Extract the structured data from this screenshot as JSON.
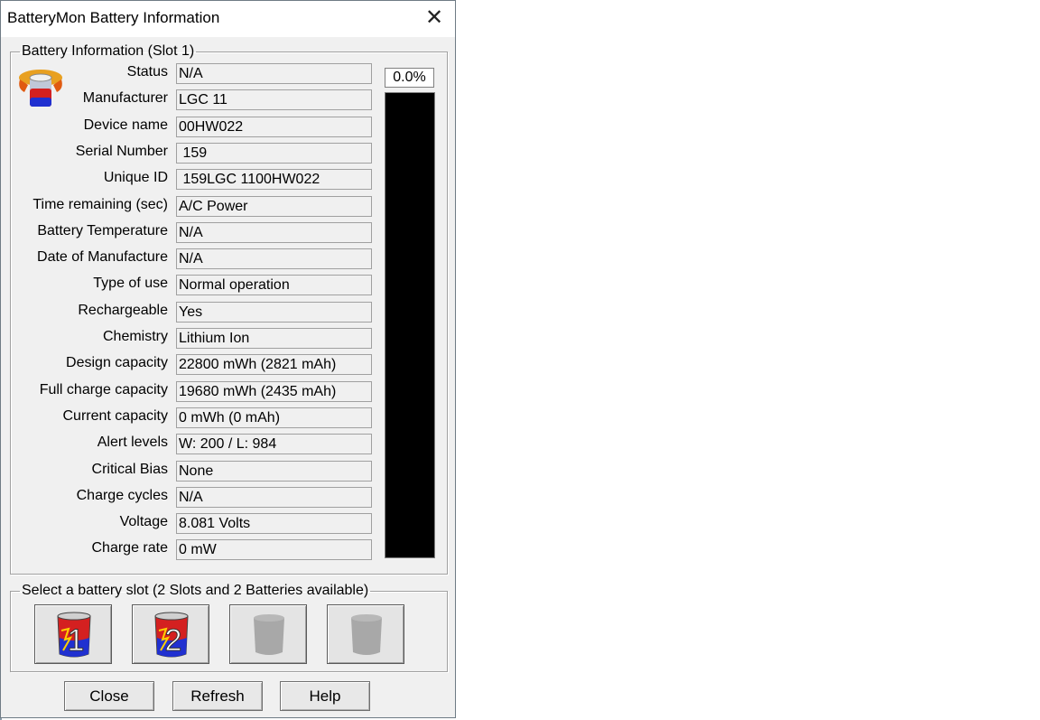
{
  "window": {
    "title": "BatteryMon Battery Information",
    "close_glyph": "✕"
  },
  "info_group": {
    "legend": "Battery Information (Slot 1)",
    "rows": [
      {
        "label": "Status",
        "value": "N/A"
      },
      {
        "label": "Manufacturer",
        "value": "LGC 11"
      },
      {
        "label": "Device name",
        "value": "00HW022"
      },
      {
        "label": "Serial Number",
        "value": " 159"
      },
      {
        "label": "Unique ID",
        "value": " 159LGC 1100HW022"
      },
      {
        "label": "Time remaining (sec)",
        "value": "A/C Power"
      },
      {
        "label": "Battery Temperature",
        "value": "N/A"
      },
      {
        "label": "Date of Manufacture",
        "value": "N/A"
      },
      {
        "label": "Type of use",
        "value": "Normal operation"
      },
      {
        "label": "Rechargeable",
        "value": "Yes"
      },
      {
        "label": "Chemistry",
        "value": "Lithium Ion"
      },
      {
        "label": "Design capacity",
        "value": "22800 mWh (2821 mAh)"
      },
      {
        "label": "Full charge capacity",
        "value": "19680 mWh (2435 mAh)"
      },
      {
        "label": "Current capacity",
        "value": "0 mWh (0 mAh)"
      },
      {
        "label": "Alert levels",
        "value": "W: 200 / L: 984"
      },
      {
        "label": "Critical Bias",
        "value": "None"
      },
      {
        "label": "Charge cycles",
        "value": "N/A"
      },
      {
        "label": "Voltage",
        "value": "8.081 Volts"
      },
      {
        "label": "Charge rate",
        "value": "0 mW"
      }
    ],
    "charge_percent_text": "0.0%",
    "charge_fraction": 0.0
  },
  "slot_group": {
    "legend": "Select a battery slot (2 Slots and 2 Batteries available)",
    "slots": [
      {
        "number": "1",
        "available": true,
        "icon": "battery-slot-1-icon"
      },
      {
        "number": "2",
        "available": true,
        "icon": "battery-slot-2-icon"
      },
      {
        "number": "",
        "available": false,
        "icon": "battery-slot-empty-icon"
      },
      {
        "number": "",
        "available": false,
        "icon": "battery-slot-empty-icon"
      }
    ]
  },
  "buttons": {
    "close": "Close",
    "refresh": "Refresh",
    "help": "Help"
  },
  "colors": {
    "meter_bg": "#000000",
    "meter_fill": "#1fbf3a",
    "battery_red": "#d42020",
    "battery_blue": "#2030d0"
  }
}
